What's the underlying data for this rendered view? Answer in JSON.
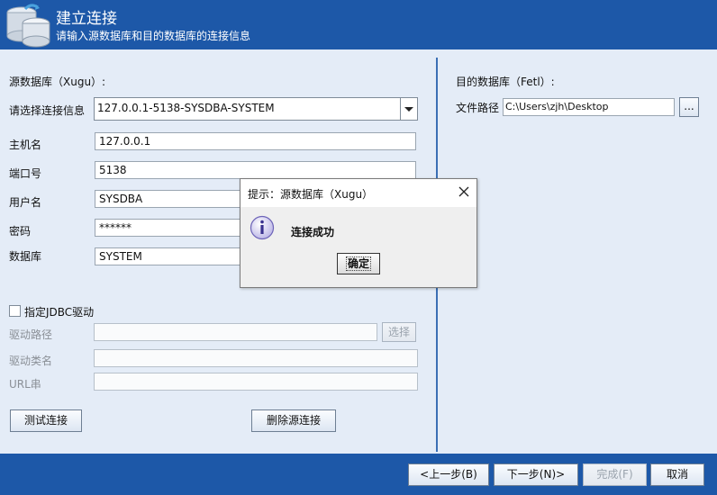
{
  "header": {
    "title": "建立连接",
    "subtitle": "请输入源数据库和目的数据库的连接信息"
  },
  "source": {
    "section_label": "源数据库（Xugu）:",
    "select_label": "请选择连接信息",
    "selected_connection": "127.0.0.1-5138-SYSDBA-SYSTEM",
    "host_label": "主机名",
    "host_value": "127.0.0.1",
    "port_label": "端口号",
    "port_value": "5138",
    "user_label": "用户名",
    "user_value": "SYSDBA",
    "password_label": "密码",
    "password_value": "******",
    "database_label": "数据库",
    "database_value": "SYSTEM",
    "jdbc_checkbox_label": "指定JDBC驱动",
    "jdbc_checked": false,
    "driver_path_label": "驱动路径",
    "driver_path_value": "",
    "choose_button": "选择",
    "driver_class_label": "驱动类名",
    "driver_class_value": "",
    "url_label": "URL串",
    "url_value": "",
    "test_button": "测试连接",
    "delete_button": "删除源连接"
  },
  "target": {
    "section_label": "目的数据库（Fetl）:",
    "file_path_label": "文件路径",
    "file_path_value": "C:\\Users\\zjh\\Desktop",
    "browse_button": "..."
  },
  "footer": {
    "prev_button": "<上一步(B)",
    "next_button": "下一步(N)>",
    "finish_button": "完成(F)",
    "cancel_button": "取消"
  },
  "dialog": {
    "title": "提示：源数据库（Xugu）",
    "message": "连接成功",
    "ok_button": "确定"
  },
  "colors": {
    "header_blue": "#1d58a8",
    "panel_bg": "#e4ecf7",
    "divider": "#3b6fb5"
  }
}
